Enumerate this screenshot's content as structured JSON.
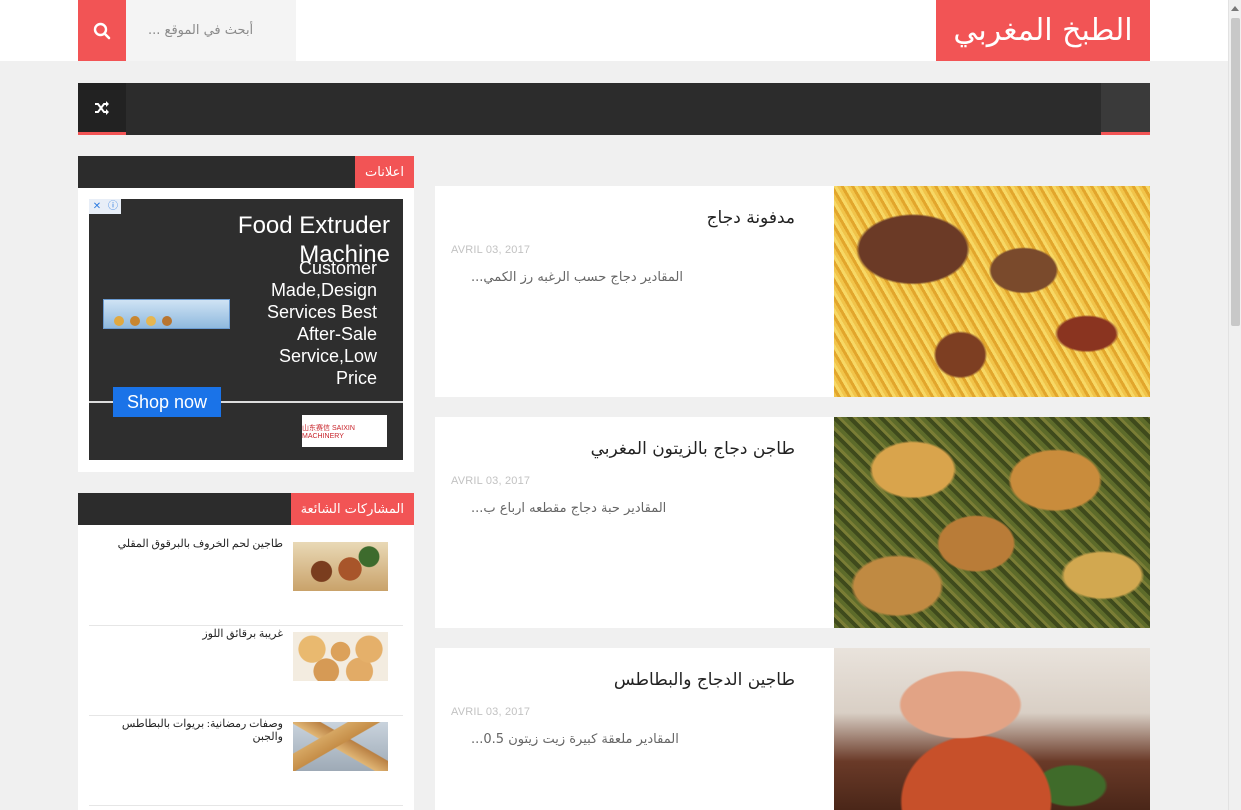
{
  "header": {
    "logo": "الطبخ المغربي",
    "search_placeholder": "أبحث في الموقع ..."
  },
  "sidebar": {
    "ads_title": "اعلانات",
    "ad": {
      "headline": "Food Extruder Machine",
      "body": "Customer Made,Design Services Best After-Sale Service,Low Price",
      "button": "Shop now",
      "brand": "山东赛信 SAIXIN MACHINERY"
    },
    "popular_title": "المشاركات الشائعة",
    "popular": [
      {
        "title": "طاجين لحم الخروف بالبرقوق المقلي"
      },
      {
        "title": "غريبة برقائق اللوز"
      },
      {
        "title": "وصفات رمضانية: بريوات بالبطاطس والجبن"
      }
    ]
  },
  "posts": [
    {
      "title": "مدفونة دجاج",
      "date": "AVRIL 03, 2017",
      "excerpt": "...المقادير دجاج حسب الرغبه رز الكمي"
    },
    {
      "title": "طاجن دجاج بالزيتون المغربي",
      "date": "AVRIL 03, 2017",
      "excerpt": "...المقادير حبة دجاج مقطعه ارباع ب"
    },
    {
      "title": "طاجين الدجاج والبطاطس",
      "date": "AVRIL 03, 2017",
      "excerpt": "...المقادير ملعقة كبيرة زيت زيتون 0.5"
    }
  ],
  "colors": {
    "accent": "#f25455",
    "dark": "#2c2c2c"
  }
}
